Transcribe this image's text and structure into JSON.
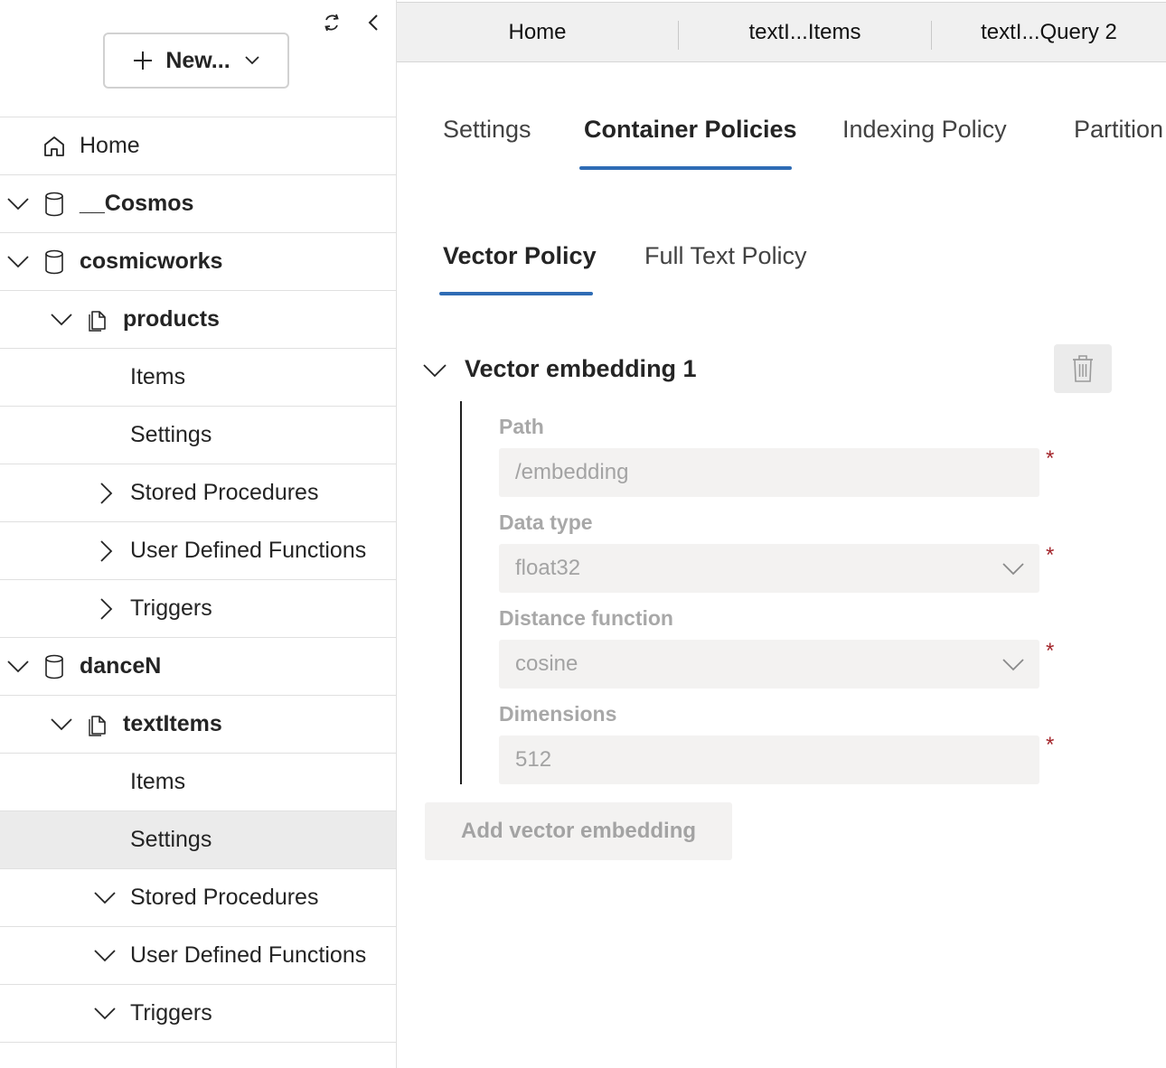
{
  "sidebar": {
    "new_button_label": "New...",
    "tree": {
      "home": "Home",
      "db_cosmos": "__Cosmos",
      "db_cosmicworks": "cosmicworks",
      "container_products": "products",
      "products_items": "Items",
      "products_settings": "Settings",
      "products_stored_procedures": "Stored Procedures",
      "products_udfs": "User Defined Functions",
      "products_triggers": "Triggers",
      "db_dancen": "danceN",
      "container_textitems": "textItems",
      "textitems_items": "Items",
      "textitems_settings": "Settings",
      "textitems_stored_procedures": "Stored Procedures",
      "textitems_udfs": "User Defined Functions",
      "textitems_triggers": "Triggers"
    }
  },
  "tabs": {
    "home": "Home",
    "items": "textI...Items",
    "query": "textI...Query 2"
  },
  "settings_tabs": {
    "settings": "Settings",
    "container_policies": "Container Policies",
    "indexing_policy": "Indexing Policy",
    "partition": "Partition"
  },
  "policy_tabs": {
    "vector_policy": "Vector Policy",
    "full_text_policy": "Full Text Policy"
  },
  "embedding": {
    "title": "Vector embedding 1",
    "path_label": "Path",
    "path_value": "/embedding",
    "data_type_label": "Data type",
    "data_type_value": "float32",
    "distance_label": "Distance function",
    "distance_value": "cosine",
    "dimensions_label": "Dimensions",
    "dimensions_value": "512",
    "required_mark": "*"
  },
  "add_button_label": "Add vector embedding",
  "colors": {
    "accent": "#2f6cb5",
    "required": "#a4262c",
    "selected_row": "#ebebeb"
  }
}
